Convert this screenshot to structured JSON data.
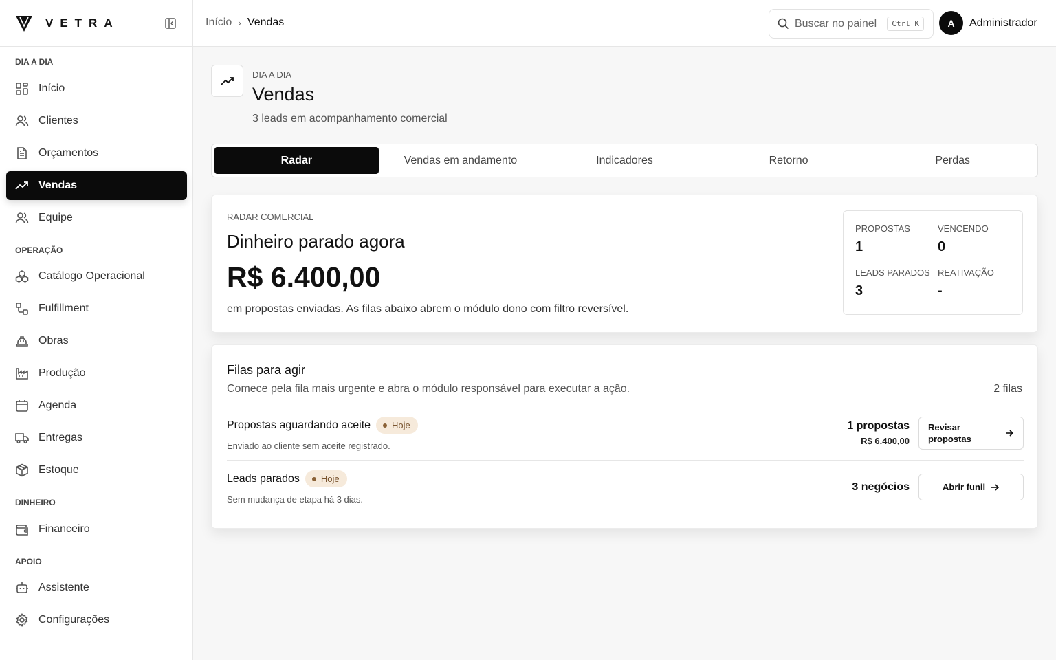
{
  "brand": {
    "name": "VETRA"
  },
  "sidebar": {
    "sections": [
      {
        "label": "DIA A DIA"
      },
      {
        "label": "OPERAÇÃO"
      },
      {
        "label": "DINHEIRO"
      },
      {
        "label": "APOIO"
      }
    ],
    "items": [
      {
        "label": "Início",
        "icon": "dashboard-icon"
      },
      {
        "label": "Clientes",
        "icon": "users-icon"
      },
      {
        "label": "Orçamentos",
        "icon": "document-icon"
      },
      {
        "label": "Vendas",
        "icon": "trending-up-icon",
        "active": true
      },
      {
        "label": "Equipe",
        "icon": "team-icon"
      },
      {
        "label": "Catálogo Operacional",
        "icon": "boxes-icon"
      },
      {
        "label": "Fulfillment",
        "icon": "workflow-icon"
      },
      {
        "label": "Obras",
        "icon": "hard-hat-icon"
      },
      {
        "label": "Produção",
        "icon": "factory-icon"
      },
      {
        "label": "Agenda",
        "icon": "calendar-icon"
      },
      {
        "label": "Entregas",
        "icon": "truck-icon"
      },
      {
        "label": "Estoque",
        "icon": "package-icon"
      },
      {
        "label": "Financeiro",
        "icon": "wallet-icon"
      },
      {
        "label": "Assistente",
        "icon": "bot-icon"
      },
      {
        "label": "Configurações",
        "icon": "gear-icon"
      }
    ]
  },
  "topbar": {
    "breadcrumb": {
      "home": "Início",
      "current": "Vendas"
    },
    "search": {
      "placeholder": "Buscar no painel",
      "shortcut": "Ctrl K"
    },
    "user": {
      "initial": "A",
      "name": "Administrador"
    }
  },
  "page": {
    "eyebrow": "DIA A DIA",
    "title": "Vendas",
    "subtitle": "3 leads em acompanhamento comercial"
  },
  "tabs": [
    {
      "label": "Radar",
      "active": true
    },
    {
      "label": "Vendas em andamento"
    },
    {
      "label": "Indicadores"
    },
    {
      "label": "Retorno"
    },
    {
      "label": "Perdas"
    }
  ],
  "radar": {
    "label": "RADAR COMERCIAL",
    "heading": "Dinheiro parado agora",
    "amount": "R$ 6.400,00",
    "description": "em propostas enviadas. As filas abaixo abrem o módulo dono com filtro reversível.",
    "stats": [
      {
        "label": "PROPOSTAS",
        "value": "1"
      },
      {
        "label": "VENCENDO",
        "value": "0"
      },
      {
        "label": "LEADS PARADOS",
        "value": "3"
      },
      {
        "label": "REATIVAÇÃO",
        "value": "-"
      }
    ]
  },
  "queues": {
    "heading": "Filas para agir",
    "subtitle": "Comece pela fila mais urgente e abra o módulo responsável para executar a ação.",
    "count": "2 filas",
    "rows": [
      {
        "title": "Propostas aguardando aceite",
        "badge": "Hoje",
        "description": "Enviado ao cliente sem aceite registrado.",
        "count": "1 propostas",
        "amount": "R$ 6.400,00",
        "action": "Revisar propostas"
      },
      {
        "title": "Leads parados",
        "badge": "Hoje",
        "description": "Sem mudança de etapa há 3 dias.",
        "count": "3 negócios",
        "action": "Abrir funil"
      }
    ]
  },
  "colors": {
    "accent": "#0b0b0b",
    "badge_bg": "#f6eadb",
    "badge_text": "#7a5530"
  }
}
